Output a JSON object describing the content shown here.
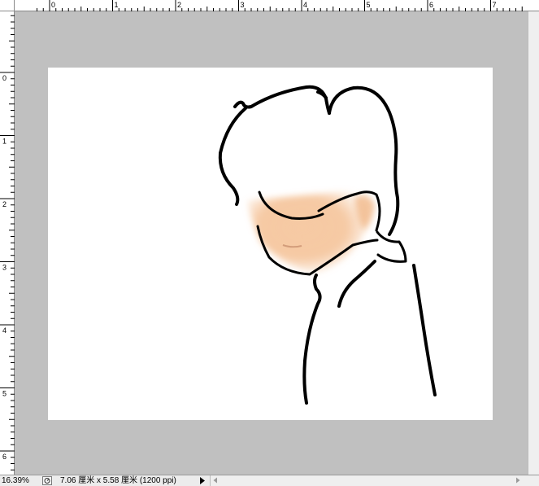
{
  "status": {
    "zoom": "16.39%",
    "document_info": "7.06 厘米 x 5.58 厘米 (1200 ppi)"
  },
  "rulers": {
    "top_labels": [
      "0",
      "1",
      "2",
      "3",
      "4",
      "5",
      "6",
      "7"
    ],
    "left_labels": [
      "0",
      "1",
      "2",
      "3",
      "4",
      "5",
      "6"
    ],
    "unit": "厘米"
  },
  "icons": {
    "status_menu": "triangle-right-icon",
    "status_doc": "document-icon",
    "scroll_left": "arrow-left-icon",
    "scroll_right": "arrow-right-icon"
  },
  "colors": {
    "workspace": "#c0c0c0",
    "canvas": "#ffffff",
    "skin": "#f3b886",
    "stroke": "#000000"
  }
}
